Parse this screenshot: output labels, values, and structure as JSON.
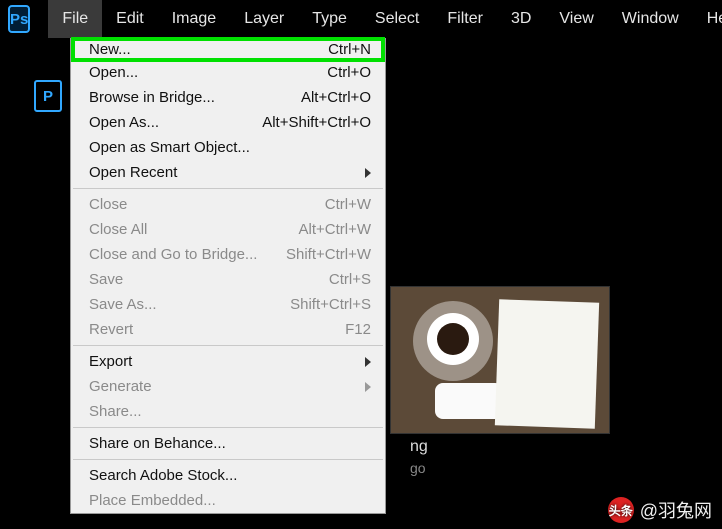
{
  "app_icon_text": "Ps",
  "doc_icon_text": "P",
  "menubar": [
    "File",
    "Edit",
    "Image",
    "Layer",
    "Type",
    "Select",
    "Filter",
    "3D",
    "View",
    "Window",
    "Help"
  ],
  "file_menu": {
    "new": {
      "label": "New...",
      "shortcut": "Ctrl+N"
    },
    "open": {
      "label": "Open...",
      "shortcut": "Ctrl+O"
    },
    "browse": {
      "label": "Browse in Bridge...",
      "shortcut": "Alt+Ctrl+O"
    },
    "open_as": {
      "label": "Open As...",
      "shortcut": "Alt+Shift+Ctrl+O"
    },
    "smart": {
      "label": "Open as Smart Object..."
    },
    "recent": {
      "label": "Open Recent"
    },
    "close": {
      "label": "Close",
      "shortcut": "Ctrl+W"
    },
    "close_all": {
      "label": "Close All",
      "shortcut": "Alt+Ctrl+W"
    },
    "close_bridge": {
      "label": "Close and Go to Bridge...",
      "shortcut": "Shift+Ctrl+W"
    },
    "save": {
      "label": "Save",
      "shortcut": "Ctrl+S"
    },
    "save_as": {
      "label": "Save As...",
      "shortcut": "Shift+Ctrl+S"
    },
    "revert": {
      "label": "Revert",
      "shortcut": "F12"
    },
    "export": {
      "label": "Export"
    },
    "generate": {
      "label": "Generate"
    },
    "share": {
      "label": "Share..."
    },
    "behance": {
      "label": "Share on Behance..."
    },
    "stock": {
      "label": "Search Adobe Stock..."
    },
    "place": {
      "label": "Place Embedded..."
    }
  },
  "thumb": {
    "title_suffix": "ng",
    "time_suffix": "go"
  },
  "watermark": {
    "badge": "头条",
    "text": "@羽兔网"
  }
}
